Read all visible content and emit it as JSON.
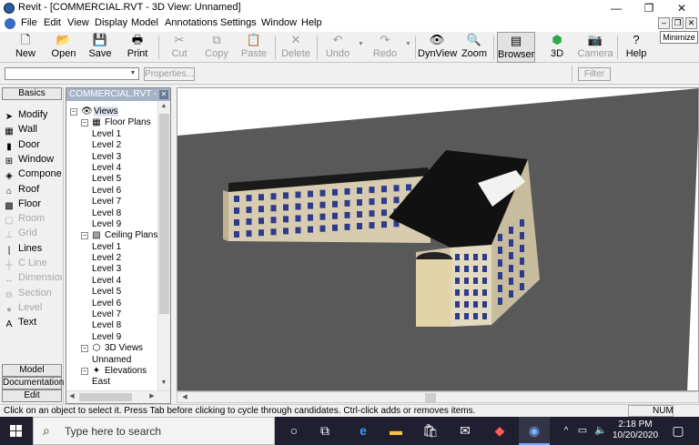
{
  "window": {
    "title": "Revit - [COMMERCIAL.RVT - 3D View: Unnamed]",
    "min_glyph": "—",
    "restore_glyph": "❐",
    "close_glyph": "✕",
    "tooltip": "Minimize"
  },
  "menu": {
    "items": [
      "File",
      "Edit",
      "View",
      "Display",
      "Model",
      "Annotations",
      "Settings",
      "Window",
      "Help"
    ],
    "mdi_min": "–",
    "mdi_restore": "❐",
    "mdi_close": "✕"
  },
  "toolbar": {
    "buttons": [
      {
        "label": "New",
        "icon": "new-document-icon",
        "glyph": "🗋"
      },
      {
        "label": "Open",
        "icon": "open-folder-icon",
        "glyph": "📂"
      },
      {
        "label": "Save",
        "icon": "save-disk-icon",
        "glyph": "💾"
      },
      {
        "label": "Print",
        "icon": "printer-icon",
        "glyph": "🖶"
      },
      {
        "label": "Cut",
        "icon": "scissors-icon",
        "glyph": "✂"
      },
      {
        "label": "Copy",
        "icon": "copy-icon",
        "glyph": "⧉"
      },
      {
        "label": "Paste",
        "icon": "paste-icon",
        "glyph": "📋"
      },
      {
        "label": "Delete",
        "icon": "delete-x-icon",
        "glyph": "✕"
      },
      {
        "label": "Undo",
        "icon": "undo-arrow-icon",
        "glyph": "↶"
      },
      {
        "label": "Redo",
        "icon": "redo-arrow-icon",
        "glyph": "↷"
      },
      {
        "label": "DynView",
        "icon": "eye-icon",
        "glyph": "👁"
      },
      {
        "label": "Zoom",
        "icon": "magnifier-icon",
        "glyph": "🔍"
      },
      {
        "label": "Browser",
        "icon": "browser-icon",
        "glyph": "▤"
      },
      {
        "label": "3D",
        "icon": "cube-3d-icon",
        "glyph": "⬢"
      },
      {
        "label": "Camera",
        "icon": "camera-icon",
        "glyph": "📷"
      },
      {
        "label": "Help",
        "icon": "help-question-icon",
        "glyph": "?"
      }
    ]
  },
  "options_bar": {
    "properties_label": "Properties...",
    "filter_label": "Filter"
  },
  "design_bar": {
    "tab_basics": "Basics",
    "items": [
      {
        "label": "Modify",
        "icon": "arrow-cursor-icon",
        "glyph": "➤"
      },
      {
        "label": "Wall",
        "icon": "wall-icon",
        "glyph": "▦"
      },
      {
        "label": "Door",
        "icon": "door-icon",
        "glyph": "▮"
      },
      {
        "label": "Window",
        "icon": "window-icon",
        "glyph": "⊞"
      },
      {
        "label": "Component",
        "icon": "component-icon",
        "glyph": "◈"
      },
      {
        "label": "Roof",
        "icon": "roof-icon",
        "glyph": "⌂"
      },
      {
        "label": "Floor",
        "icon": "floor-icon",
        "glyph": "▩"
      },
      {
        "label": "Room",
        "icon": "room-icon",
        "glyph": "▢"
      },
      {
        "label": "Grid",
        "icon": "grid-icon",
        "glyph": "⊥"
      },
      {
        "label": "Lines",
        "icon": "lines-icon",
        "glyph": "|"
      },
      {
        "label": "C Line",
        "icon": "center-line-icon",
        "glyph": "┼"
      },
      {
        "label": "Dimension",
        "icon": "dimension-icon",
        "glyph": "↔"
      },
      {
        "label": "Section",
        "icon": "section-icon",
        "glyph": "⊖"
      },
      {
        "label": "Level",
        "icon": "level-icon",
        "glyph": "●"
      },
      {
        "label": "Text",
        "icon": "text-icon",
        "glyph": "A"
      }
    ],
    "tab_model": "Model",
    "tab_documentation": "Documentation",
    "tab_edit": "Edit"
  },
  "browser": {
    "title": "COMMERCIAL.RVT - ...",
    "tree": [
      {
        "label": "Views",
        "level": 0,
        "type": "group",
        "glyph": "👁"
      },
      {
        "label": "Floor Plans",
        "level": 1,
        "type": "group",
        "glyph": "▦"
      },
      {
        "label": "Level 1",
        "level": 2,
        "type": "leaf"
      },
      {
        "label": "Level 2",
        "level": 2,
        "type": "leaf"
      },
      {
        "label": "Level 3",
        "level": 2,
        "type": "leaf"
      },
      {
        "label": "Level 4",
        "level": 2,
        "type": "leaf"
      },
      {
        "label": "Level 5",
        "level": 2,
        "type": "leaf"
      },
      {
        "label": "Level 6",
        "level": 2,
        "type": "leaf"
      },
      {
        "label": "Level 7",
        "level": 2,
        "type": "leaf"
      },
      {
        "label": "Level 8",
        "level": 2,
        "type": "leaf"
      },
      {
        "label": "Level 9",
        "level": 2,
        "type": "leaf"
      },
      {
        "label": "Ceiling Plans",
        "level": 1,
        "type": "group",
        "glyph": "▧"
      },
      {
        "label": "Level 1",
        "level": 2,
        "type": "leaf"
      },
      {
        "label": "Level 2",
        "level": 2,
        "type": "leaf"
      },
      {
        "label": "Level 3",
        "level": 2,
        "type": "leaf"
      },
      {
        "label": "Level 4",
        "level": 2,
        "type": "leaf"
      },
      {
        "label": "Level 5",
        "level": 2,
        "type": "leaf"
      },
      {
        "label": "Level 6",
        "level": 2,
        "type": "leaf"
      },
      {
        "label": "Level 7",
        "level": 2,
        "type": "leaf"
      },
      {
        "label": "Level 8",
        "level": 2,
        "type": "leaf"
      },
      {
        "label": "Level 9",
        "level": 2,
        "type": "leaf"
      },
      {
        "label": "3D Views",
        "level": 1,
        "type": "group",
        "glyph": "⬡"
      },
      {
        "label": "Unnamed",
        "level": 2,
        "type": "leaf"
      },
      {
        "label": "Elevations",
        "level": 1,
        "type": "group",
        "glyph": "✦"
      },
      {
        "label": "East",
        "level": 2,
        "type": "leaf"
      }
    ]
  },
  "status": {
    "message": "Click on an object to select it. Press Tab before clicking to cycle through candidates. Ctrl-click adds or removes items.",
    "num": "NUM"
  },
  "taskbar": {
    "search_placeholder": "Type here to search",
    "time": "2:18 PM",
    "date": "10/20/2020"
  }
}
